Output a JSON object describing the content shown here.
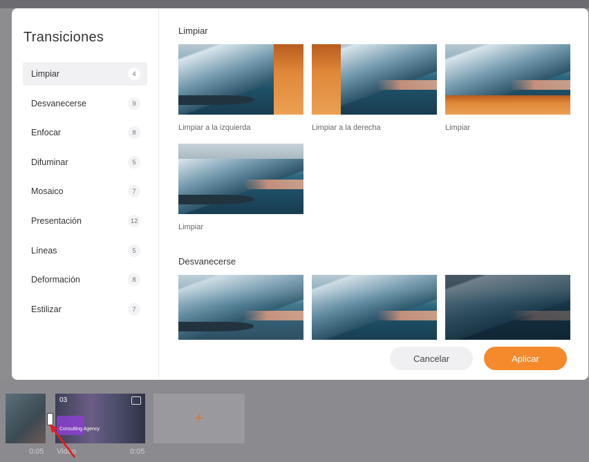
{
  "dialog": {
    "title": "Transiciones",
    "categories": [
      {
        "label": "Limpiar",
        "count": "4"
      },
      {
        "label": "Desvanecerse",
        "count": "9"
      },
      {
        "label": "Enfocar",
        "count": "8"
      },
      {
        "label": "Difuminar",
        "count": "5"
      },
      {
        "label": "Mosaico",
        "count": "7"
      },
      {
        "label": "Presentación",
        "count": "12"
      },
      {
        "label": "Líneas",
        "count": "5"
      },
      {
        "label": "Deformación",
        "count": "8"
      },
      {
        "label": "Estilizar",
        "count": "7"
      }
    ],
    "active_category": "Limpiar",
    "sections": [
      {
        "title": "Limpiar",
        "items": [
          {
            "caption": "Limpiar a la izquierda"
          },
          {
            "caption": "Limpiar a la derecha"
          },
          {
            "caption": "Limpiar"
          },
          {
            "caption": "Limpiar"
          }
        ]
      },
      {
        "title": "Desvanecerse",
        "items": [
          {
            "caption": ""
          },
          {
            "caption": ""
          },
          {
            "caption": ""
          }
        ]
      }
    ],
    "buttons": {
      "cancel": "Cancelar",
      "apply": "Aplicar"
    }
  },
  "timeline": {
    "clip1_duration": "0:05",
    "clip2_label": "Video",
    "clip2_duration": "0:05",
    "clip2_number": "03",
    "add_symbol": "+",
    "clip2_caption": "Consulting Agency"
  },
  "colors": {
    "accent": "#f58a2d",
    "active_bg": "#f1f1f3"
  }
}
